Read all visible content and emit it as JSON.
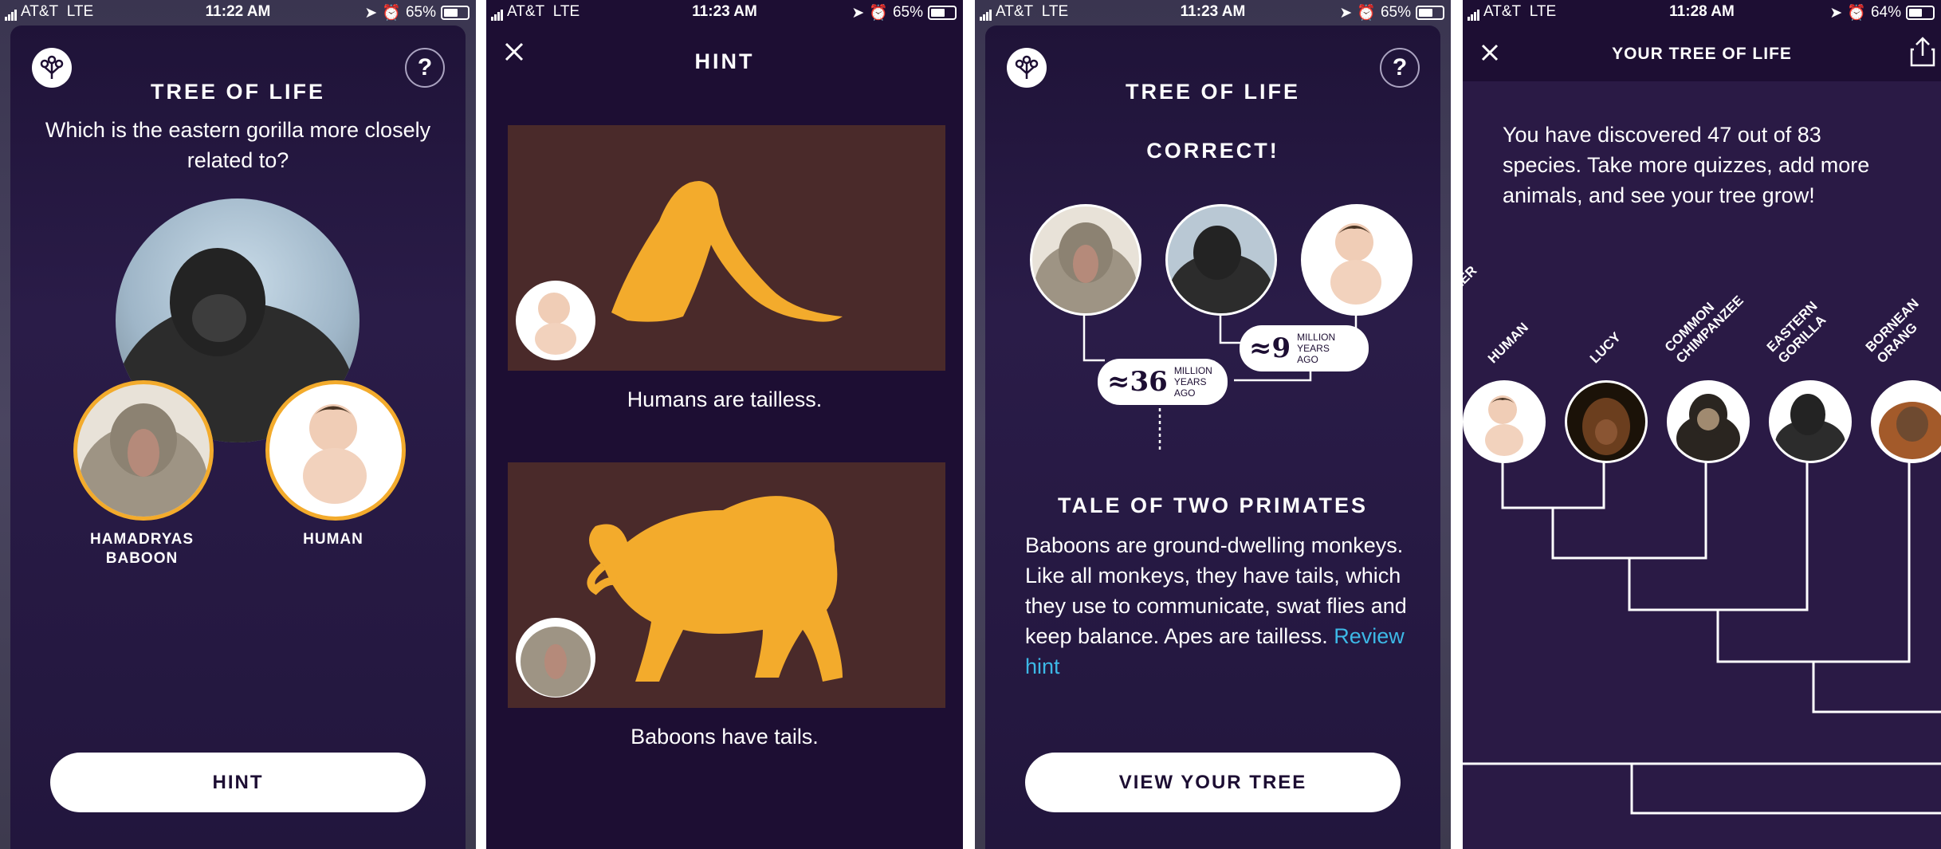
{
  "screens": [
    {
      "status": {
        "carrier": "AT&T",
        "network": "LTE",
        "time": "11:22 AM",
        "battery": "65%"
      },
      "title": "TREE OF LIFE",
      "help_label": "?",
      "question": "Which is the eastern gorilla more closely related to?",
      "option_left": {
        "label_line1": "HAMADRYAS",
        "label_line2": "BABOON"
      },
      "option_right": {
        "label": "HUMAN"
      },
      "button": "HINT"
    },
    {
      "status": {
        "carrier": "AT&T",
        "network": "LTE",
        "time": "11:23 AM",
        "battery": "65%"
      },
      "title": "HINT",
      "hint1": "Humans are tailless.",
      "hint2": "Baboons have tails."
    },
    {
      "status": {
        "carrier": "AT&T",
        "network": "LTE",
        "time": "11:23 AM",
        "battery": "65%"
      },
      "title": "TREE OF LIFE",
      "help_label": "?",
      "result": "CORRECT!",
      "bubble1": {
        "approx": "≈36",
        "l1": "MILLION",
        "l2": "YEARS",
        "l3": "AGO"
      },
      "bubble2": {
        "approx": "≈9",
        "l1": "MILLION",
        "l2": "YEARS",
        "l3": "AGO"
      },
      "subtitle": "TALE OF TWO PRIMATES",
      "body": "Baboons are ground-dwelling monkeys. Like all monkeys, they have tails, which they use to communicate, swat flies and keep balance. Apes are tailless. ",
      "link": "Review hint",
      "button": "VIEW YOUR TREE"
    },
    {
      "status": {
        "carrier": "AT&T",
        "network": "LTE",
        "time": "11:28 AM",
        "battery": "64%"
      },
      "title": "YOUR TREE OF LIFE",
      "intro": "You have discovered 47 out of 83 species. Take more quizzes, add more animals, and see your tree grow!",
      "labels": {
        "partial": "LER",
        "human": "HUMAN",
        "lucy": "LUCY",
        "chimp1": "COMMON",
        "chimp2": "CHIMPANZEE",
        "gorilla1": "EASTERN",
        "gorilla2": "GORILLA",
        "orang1": "BORNEAN",
        "orang2": "ORANG"
      }
    }
  ],
  "colors": {
    "card_bg": "#22163d",
    "accent_gold": "#f3ab2c",
    "link_blue": "#3db8e6",
    "hint_panel": "#4a2a2a"
  }
}
